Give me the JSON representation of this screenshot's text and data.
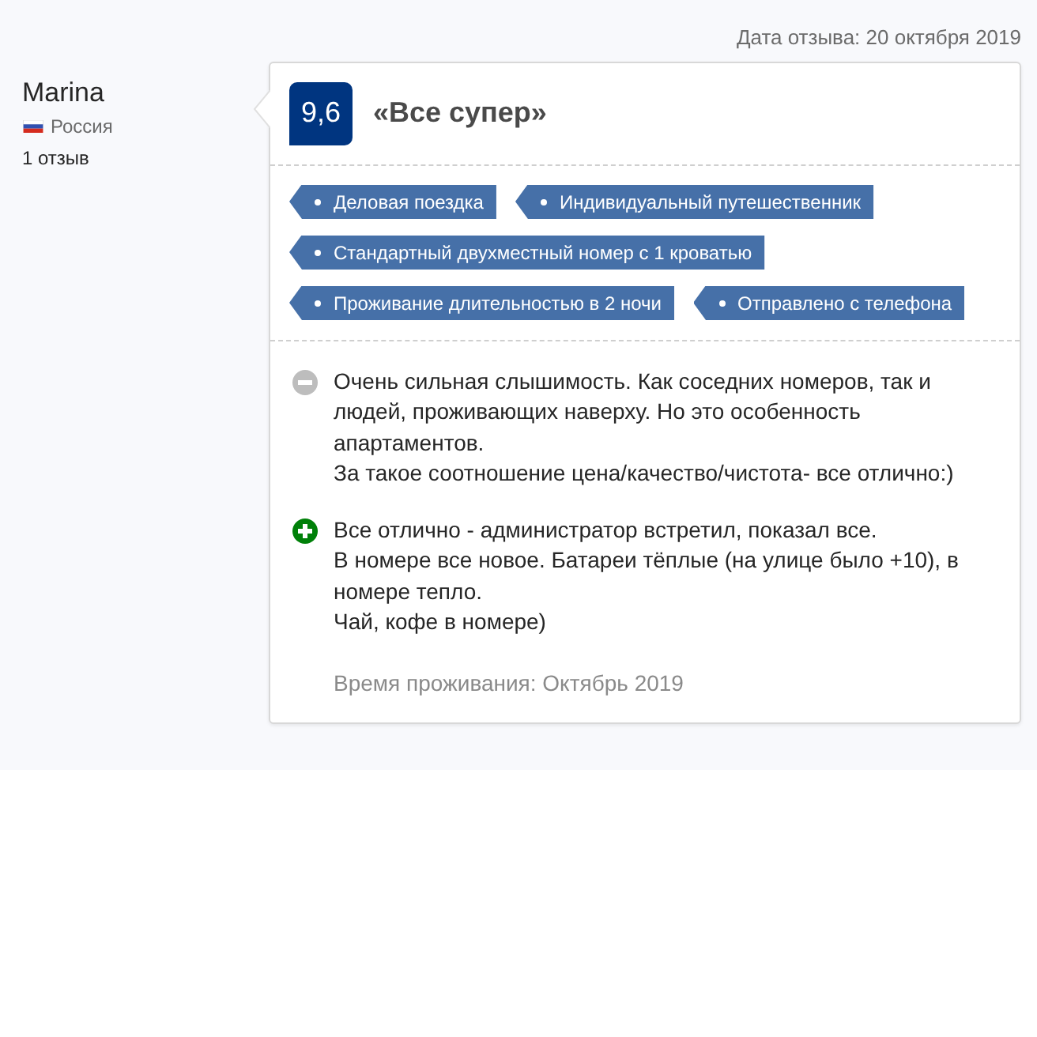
{
  "review_date": "Дата отзыва: 20 октября 2019",
  "reviewer": {
    "name": "Marina",
    "country": "Россия",
    "review_count": "1 отзыв"
  },
  "score": "9,6",
  "title": "«Все супер»",
  "tags": [
    {
      "label": "Деловая поездка"
    },
    {
      "label": "Индивидуальный путешественник"
    },
    {
      "label": "Стандартный двухместный номер с 1 кроватью"
    },
    {
      "label": "Проживание длительностью в 2 ночи"
    },
    {
      "label": "Отправлено с телефона"
    }
  ],
  "comments": [
    {
      "kind": "negative",
      "text": "Очень сильная слышимость. Как соседних номеров, так и людей, проживающих наверху. Но это особенность апартаментов.\nЗа такое соотношение цена/качество/чистота- все отлично:)"
    },
    {
      "kind": "positive",
      "text": "Все отлично - администратор встретил, показал все.\nВ номере все новое. Батареи тёплые (на улице было +10), в номере тепло.\nЧай, кофе в номере)"
    }
  ],
  "stay_period": "Время проживания: Октябрь 2019"
}
